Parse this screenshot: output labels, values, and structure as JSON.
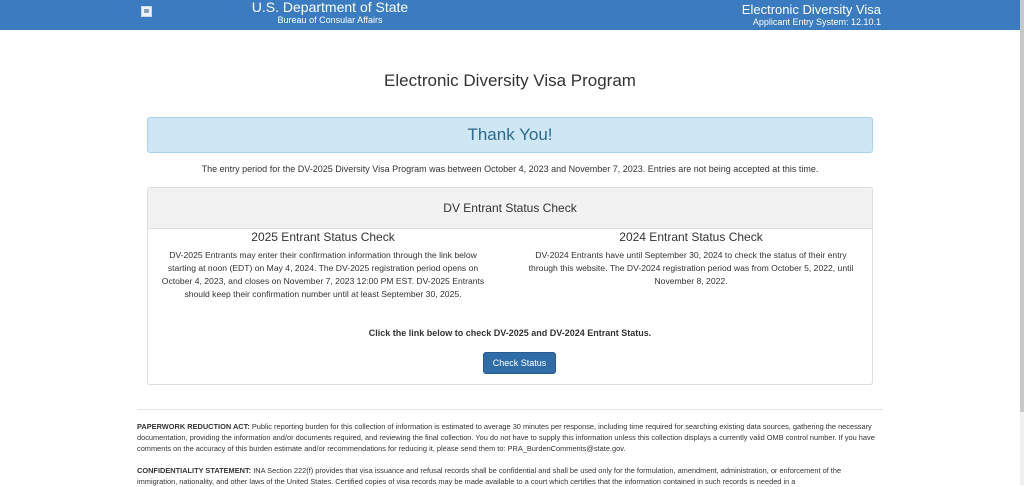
{
  "header": {
    "dept_title": "U.S. Department of State",
    "bureau": "Bureau of Consular Affairs",
    "app_title": "Electronic Diversity Visa",
    "system_version": "Applicant Entry System: 12.10.1",
    "colors": {
      "bar": "#3b7bbf",
      "text": "#ffffff"
    }
  },
  "page": {
    "title": "Electronic Diversity Visa Program"
  },
  "alert": {
    "text": "Thank You!"
  },
  "period_notice": "The entry period for the DV-2025 Diversity Visa Program was between October 4, 2023 and November 7, 2023. Entries are not being accepted at this time.",
  "status_panel": {
    "heading": "DV Entrant Status Check",
    "left": {
      "title": "2025 Entrant Status Check",
      "body": "DV-2025 Entrants may enter their confirmation information through the link below starting at noon (EDT) on May 4, 2024. The DV-2025 registration period opens on October 4, 2023, and closes on November 7, 2023 12:00 PM EST. DV-2025 Entrants should keep their confirmation number until at least September 30, 2025."
    },
    "right": {
      "title": "2024 Entrant Status Check",
      "body": "DV-2024 Entrants have until September 30, 2024 to check the status of their entry through this website. The DV-2024 registration period was from October 5, 2022, until November 8, 2022."
    },
    "cta": "Click the link below to check DV-2025 and DV-2024 Entrant Status.",
    "button_label": "Check Status"
  },
  "footer": {
    "paperwork_label": "PAPERWORK REDUCTION ACT:",
    "paperwork_text": " Public reporting burden for this collection of information is estimated to average 30 minutes per response, including time required for searching existing data sources, gathering the necessary documentation, providing the information and/or documents required, and reviewing the final collection. You do not have to supply this information unless this collection displays a currently valid OMB control number. If you have comments on the accuracy of this burden estimate and/or recommendations for reducing it, please send them to: PRA_BurdenComments@state.gov.",
    "confidentiality_label": "CONFIDENTIALITY STATEMENT:",
    "confidentiality_text": " INA Section 222(f) provides that visa issuance and refusal records shall be confidential and shall be used only for the formulation, amendment, administration, or enforcement of the immigration, nationality, and other laws of the United States. Certified copies of visa records may be made available to a court which certifies that the information contained in such records is needed in a"
  }
}
